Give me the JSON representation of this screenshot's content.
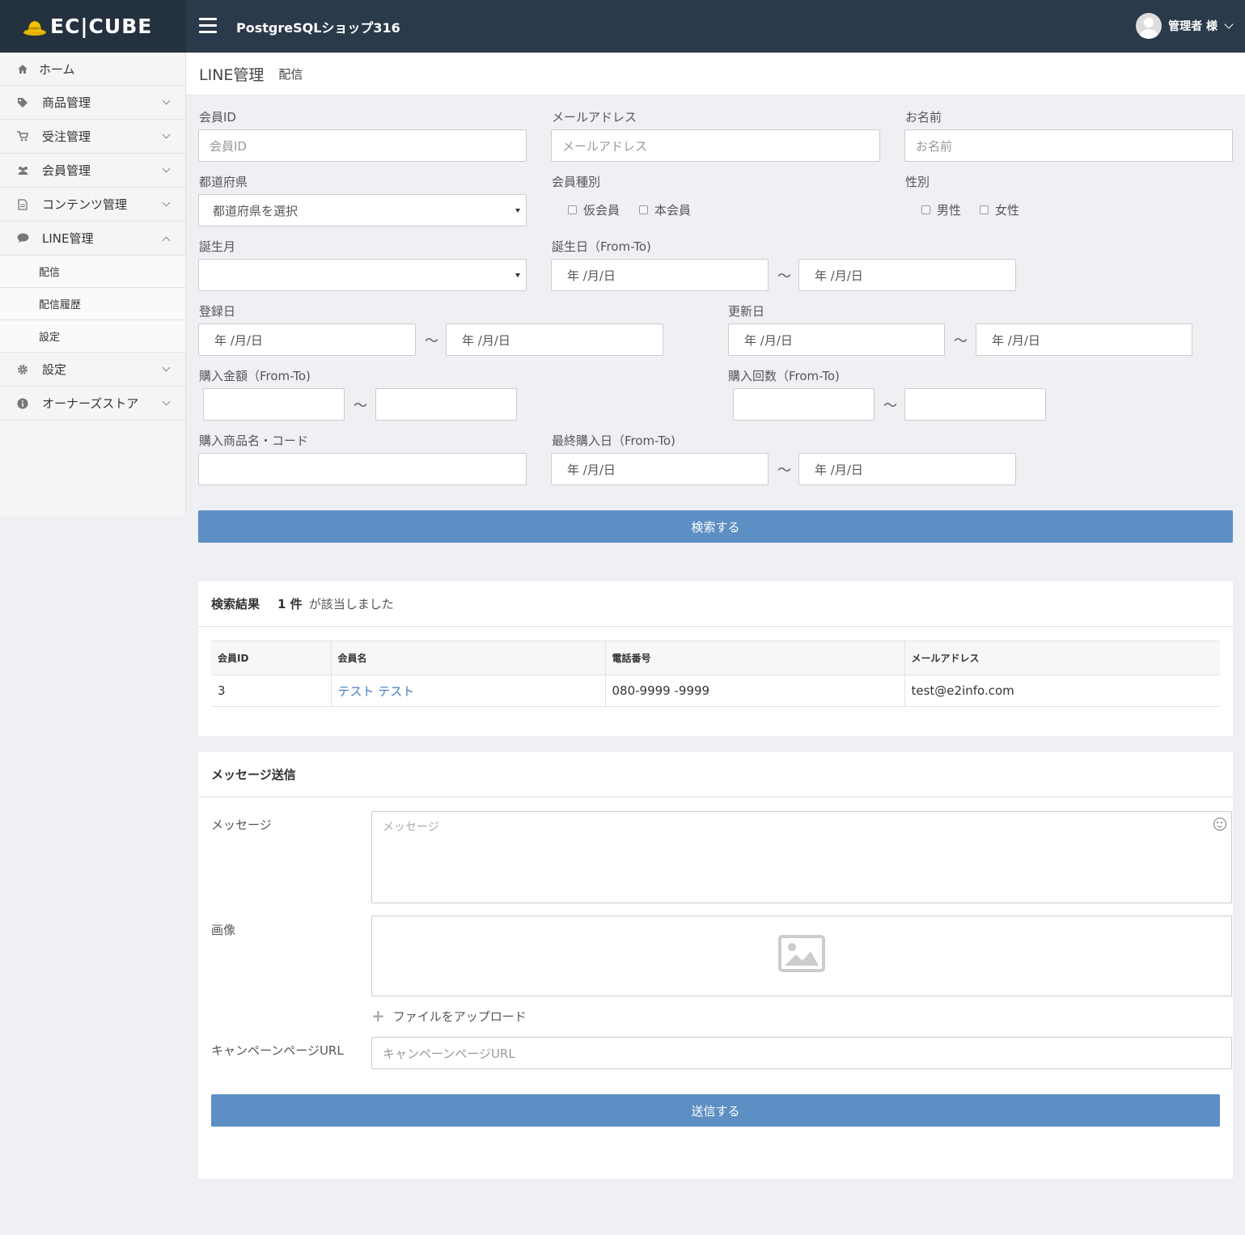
{
  "header": {
    "logo": "EC|CUBE",
    "shop_name": "PostgreSQLショップ316",
    "user": "管理者 様"
  },
  "sidebar": {
    "items": [
      {
        "label": "ホーム",
        "icon": "home-icon"
      },
      {
        "label": "商品管理",
        "icon": "tag-icon"
      },
      {
        "label": "受注管理",
        "icon": "cart-icon"
      },
      {
        "label": "会員管理",
        "icon": "users-icon"
      },
      {
        "label": "コンテンツ管理",
        "icon": "file-icon"
      },
      {
        "label": "LINE管理",
        "icon": "comment-icon"
      },
      {
        "label": "設定",
        "icon": "gear-icon"
      },
      {
        "label": "オーナーズストア",
        "icon": "info-icon"
      }
    ],
    "line_sub": [
      "配信",
      "配信履歴",
      "設定"
    ]
  },
  "page": {
    "title": "LINE管理",
    "subtitle": "配信"
  },
  "search": {
    "member_id_label": "会員ID",
    "member_id_placeholder": "会員ID",
    "email_label": "メールアドレス",
    "email_placeholder": "メールアドレス",
    "name_label": "お名前",
    "name_placeholder": "お名前",
    "pref_label": "都道府県",
    "pref_value": "都道府県を選択",
    "member_type_label": "会員種別",
    "member_type_options": [
      "仮会員",
      "本会員"
    ],
    "sex_label": "性別",
    "sex_options": [
      "男性",
      "女性"
    ],
    "birth_month_label": "誕生月",
    "birth_month_value": "",
    "birthday_label": "誕生日（From-To)",
    "date_placeholder": "年 /月/日",
    "tilde": "〜",
    "create_date_label": "登録日",
    "update_date_label": "更新日",
    "buy_total_label": "購入金額（From-To)",
    "buy_times_label": "購入回数（From-To)",
    "buy_product_label": "購入商品名・コード",
    "last_buy_label": "最終購入日（From-To)",
    "submit_label": "検索する"
  },
  "results": {
    "title": "検索結果",
    "count": "1 件",
    "suffix": "が該当しました",
    "columns": [
      "会員ID",
      "会員名",
      "電話番号",
      "メールアドレス"
    ],
    "rows": [
      {
        "id": "3",
        "name": "テスト テスト",
        "phone": "080-9999 -9999",
        "email": "test@e2info.com"
      }
    ]
  },
  "message": {
    "title": "メッセージ送信",
    "message_label": "メッセージ",
    "message_placeholder": "メッセージ",
    "image_label": "画像",
    "upload_label": "ファイルをアップロード",
    "campaign_label": "キャンペーンページURL",
    "campaign_placeholder": "キャンペーンページURL",
    "send_label": "送信する"
  }
}
